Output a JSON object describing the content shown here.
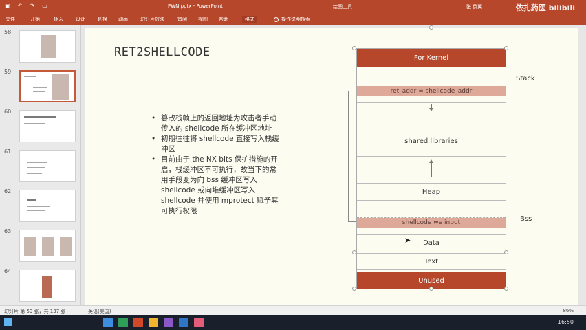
{
  "window": {
    "doc_title": "PWN.pptx",
    "app_name": "PowerPoint",
    "tool_tab": "绘图工具",
    "user": "张 倒翼",
    "watermark": "依扎药医 bilibili"
  },
  "ribbon": {
    "tabs": [
      "文件",
      "开始",
      "插入",
      "设计",
      "切换",
      "动画",
      "幻灯片放映",
      "审阅",
      "视图",
      "帮助",
      "格式"
    ],
    "active_tab": "格式",
    "search_placeholder": "操作说明搜索"
  },
  "thumbnails": [
    {
      "num": "58"
    },
    {
      "num": "59"
    },
    {
      "num": "60"
    },
    {
      "num": "61"
    },
    {
      "num": "62"
    },
    {
      "num": "63"
    },
    {
      "num": "64"
    }
  ],
  "slide": {
    "title_a": "RET",
    "title_b": "2",
    "title_c": "SHELLCODE",
    "bullets": [
      "篡改栈帧上的返回地址为攻击者手动传入的 shellcode 所在缓冲区地址",
      "初期往往将 shellcode 直接写入栈缓冲区",
      "目前由于 the NX bits 保护措施的开启，栈缓冲区不可执行，故当下的常用手段变为向 bss 缓冲区写入 shellcode 或向堆缓冲区写入 shellcode 并使用 mprotect 赋予其可执行权限"
    ],
    "memory": {
      "kernel": "For Kernel",
      "ret_addr": "ret_addr = shellcode_addr",
      "shared": "shared libraries",
      "heap": "Heap",
      "shellcode": "shellcode we input",
      "data": "Data",
      "text": "Text",
      "unused": "Unused",
      "label_stack": "Stack",
      "label_bss": "Bss"
    }
  },
  "status": {
    "slide_pos": "幻灯片 第 59 张，共 137 张",
    "language": "英语(美国)",
    "zoom": "86%"
  },
  "taskbar": {
    "time": "16:50"
  },
  "colors": {
    "accent": "#b7472a",
    "pink": "#dfa99a",
    "slide_bg": "#fdfcf1"
  }
}
